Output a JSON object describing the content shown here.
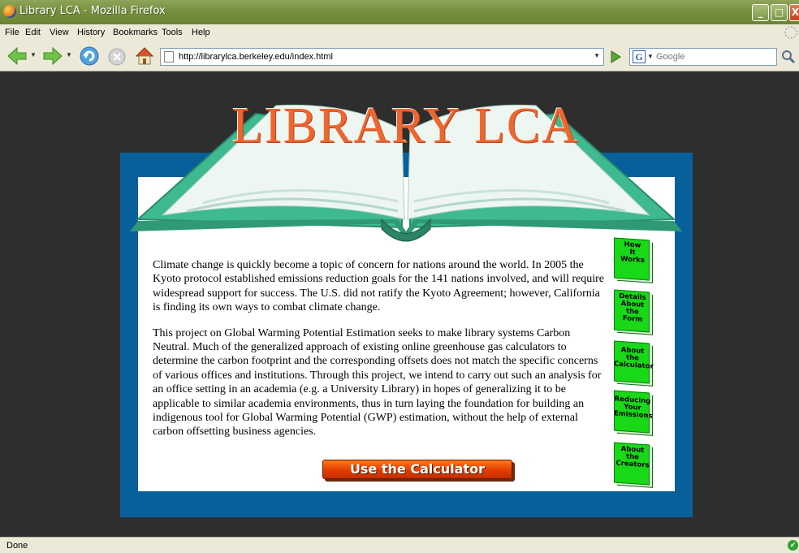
{
  "window": {
    "title": "Library LCA - Mozilla Firefox",
    "controls": {
      "minimize": "_",
      "maximize": "□",
      "close": "X"
    }
  },
  "menubar": {
    "items": [
      "File",
      "Edit",
      "View",
      "History",
      "Bookmarks",
      "Tools",
      "Help"
    ]
  },
  "toolbar": {
    "url": "http://librarylca.berkeley.edu/index.html",
    "search_placeholder": "Google",
    "search_engine_glyph": "G"
  },
  "page": {
    "site_title": "LIBRARY LCA",
    "paragraphs": [
      "Climate change is quickly become a topic of concern for nations around the world. In 2005 the Kyoto protocol established emissions reduction goals for the 141 nations involved, and will require widespread support for success. The U.S. did not ratify the Kyoto Agreement; however, California is finding its own ways to combat climate change.",
      "This project on Global Warming Potential Estimation seeks to make library systems Carbon Neutral.  Much of the generalized approach of existing online greenhouse gas calculators to determine the carbon footprint and the corresponding offsets does not match the specific concerns of various offices and institutions. Through this project, we intend to carry out such an analysis for an office setting in an academia (e.g. a University Library) in hopes of generalizing it to be applicable to similar academia environments, thus in turn laying the foundation for building an indigenous tool for Global Warming Potential (GWP) estimation, without the help of external carbon offsetting business agencies."
    ],
    "calculator_button": "Use the Calculator",
    "side_nav": [
      "How\nIt\nWorks",
      "Details\nAbout\nthe\nForm",
      "About\nthe\nCalculator",
      "Reducing\nYour\nEmissions",
      "About\nthe\nCreators"
    ]
  },
  "statusbar": {
    "text": "Done"
  },
  "colors": {
    "title_orange": "#ee6530",
    "frame_blue": "#07609a",
    "nav_green": "#18d818",
    "book_teal": "#3fb98f"
  }
}
